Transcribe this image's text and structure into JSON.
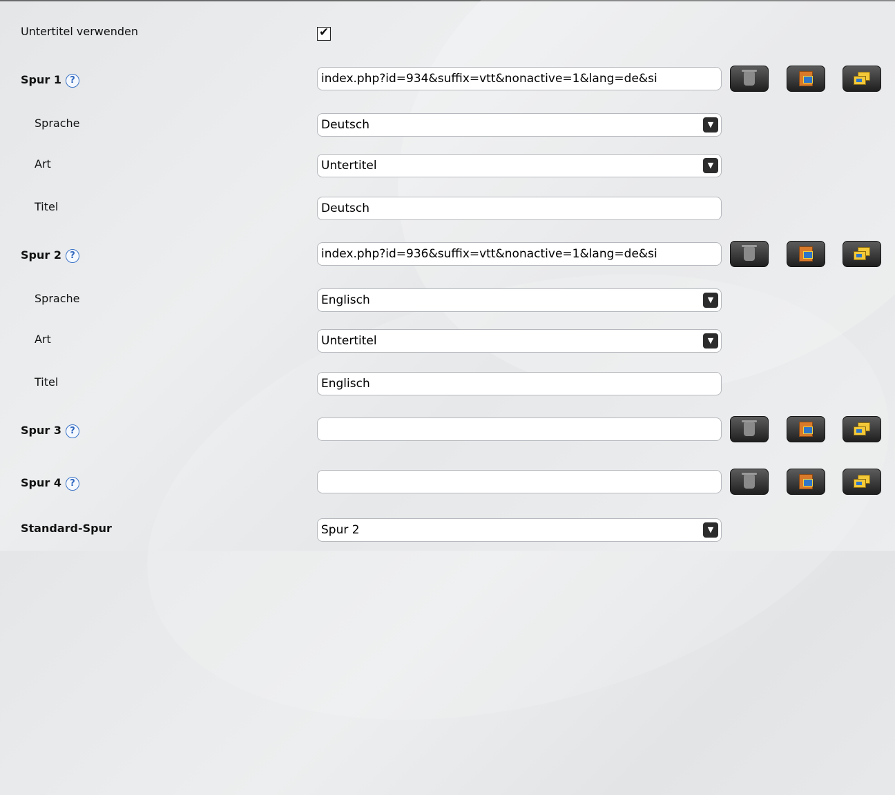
{
  "subtitles_label": "Untertitel verwenden",
  "subtitles_checked": true,
  "help_glyph": "?",
  "select_arrow_glyph": "▼",
  "checkbox_glyph": "✔",
  "tracks": [
    {
      "label": "Spur 1",
      "url": "index.php?id=934&suffix=vtt&nonactive=1&lang=de&si",
      "language_label": "Sprache",
      "language": "Deutsch",
      "kind_label": "Art",
      "kind": "Untertitel",
      "title_label": "Titel",
      "title": "Deutsch"
    },
    {
      "label": "Spur 2",
      "url": "index.php?id=936&suffix=vtt&nonactive=1&lang=de&si",
      "language_label": "Sprache",
      "language": "Englisch",
      "kind_label": "Art",
      "kind": "Untertitel",
      "title_label": "Titel",
      "title": "Englisch"
    },
    {
      "label": "Spur 3",
      "url": ""
    },
    {
      "label": "Spur 4",
      "url": ""
    }
  ],
  "default_track_label": "Standard-Spur",
  "default_track_value": "Spur 2",
  "icons": {
    "delete": "trash-icon",
    "choose_file": "file-browse-icon",
    "choose_from_server": "server-files-icon"
  }
}
